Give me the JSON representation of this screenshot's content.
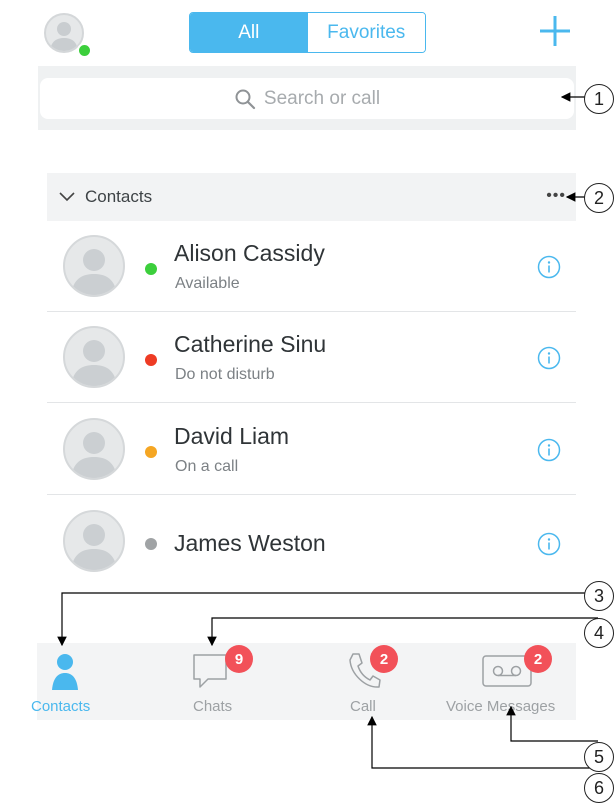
{
  "header": {
    "segments": {
      "all": "All",
      "favorites": "Favorites"
    },
    "plus_icon": "plus-icon",
    "presence_color": "#3ccf3c"
  },
  "search": {
    "placeholder": "Search or call",
    "icon": "search-icon"
  },
  "contacts": {
    "section_title": "Contacts",
    "more_label": "•••",
    "rows": [
      {
        "name": "Alison Cassidy",
        "status": "Available",
        "dot_color": "#3ccf3c"
      },
      {
        "name": "Catherine Sinu",
        "status": "Do not disturb",
        "dot_color": "#ee3b24"
      },
      {
        "name": "David Liam",
        "status": "On a call",
        "dot_color": "#f5a623"
      },
      {
        "name": "James Weston",
        "status": "",
        "dot_color": "#a0a3a5"
      }
    ]
  },
  "tabs": {
    "contacts": {
      "label": "Contacts",
      "icon": "person-icon",
      "active": true
    },
    "chats": {
      "label": "Chats",
      "icon": "chat-bubble-icon",
      "badge": "9"
    },
    "call": {
      "label": "Call",
      "icon": "phone-icon",
      "badge": "2"
    },
    "voice": {
      "label": "Voice Messages",
      "icon": "voicemail-icon",
      "badge": "2"
    }
  },
  "callouts": [
    "1",
    "2",
    "3",
    "4",
    "5",
    "5",
    "6"
  ],
  "colors": {
    "accent": "#4ab8ee",
    "badge": "#f25159"
  }
}
